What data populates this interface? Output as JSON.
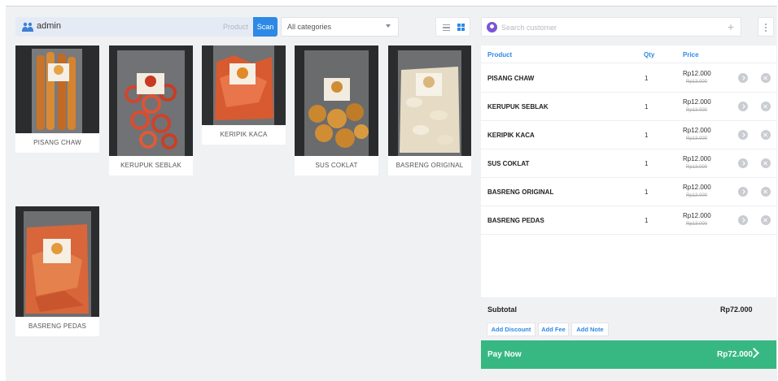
{
  "header": {
    "user_name": "admin",
    "product_placeholder": "Product",
    "scan_label": "Scan",
    "category_value": "All categories",
    "customer_placeholder": "Search customer"
  },
  "products": [
    {
      "name": "PISANG CHAW"
    },
    {
      "name": "KERUPUK SEBLAK"
    },
    {
      "name": "KERIPIK KACA"
    },
    {
      "name": "SUS COKLAT"
    },
    {
      "name": "BASRENG ORIGINAL"
    },
    {
      "name": "BASRENG PEDAS"
    }
  ],
  "cart": {
    "columns": {
      "product": "Product",
      "qty": "Qty",
      "price": "Price"
    },
    "items": [
      {
        "product": "PISANG CHAW",
        "qty": "1",
        "price": "Rp12.000",
        "original_price": "Rp13.000"
      },
      {
        "product": "KERUPUK SEBLAK",
        "qty": "1",
        "price": "Rp12.000",
        "original_price": "Rp13.000"
      },
      {
        "product": "KERIPIK KACA",
        "qty": "1",
        "price": "Rp12.000",
        "original_price": "Rp13.000"
      },
      {
        "product": "SUS COKLAT",
        "qty": "1",
        "price": "Rp12.000",
        "original_price": "Rp13.000"
      },
      {
        "product": "BASRENG ORIGINAL",
        "qty": "1",
        "price": "Rp12.000",
        "original_price": "Rp13.000"
      },
      {
        "product": "BASRENG PEDAS",
        "qty": "1",
        "price": "Rp12.000",
        "original_price": "Rp13.000"
      }
    ],
    "subtotal_label": "Subtotal",
    "subtotal_value": "Rp72.000",
    "add_discount_label": "Add Discount",
    "add_fee_label": "Add Fee",
    "add_note_label": "Add Note",
    "pay_label": "Pay Now",
    "pay_value": "Rp72.000"
  },
  "colors": {
    "accent": "#2d89e5",
    "pay_green": "#37b882",
    "customer_icon": "#7b55d6"
  },
  "icons": [
    "user-icon",
    "list-view-icon",
    "grid-view-icon",
    "customer-icon",
    "plus-icon",
    "more-icon",
    "go-icon",
    "delete-icon",
    "chevron-right-icon"
  ]
}
